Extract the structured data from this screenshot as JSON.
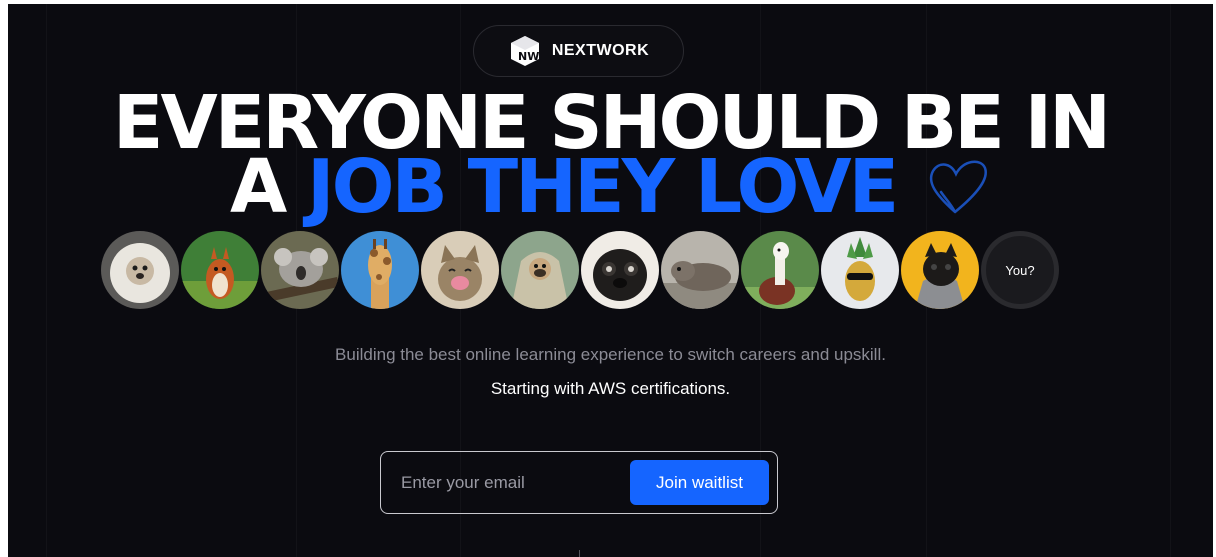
{
  "brand": {
    "logo_mark": "NW",
    "name": "NEXTWORK"
  },
  "hero": {
    "line1": "EVERYONE SHOULD BE IN",
    "line2_prefix": "A",
    "line2_highlight": "JOB THEY LOVE",
    "heart_icon": "heart-outline-icon"
  },
  "avatars": [
    {
      "name": "white-fluffy-dog"
    },
    {
      "name": "squirrel"
    },
    {
      "name": "koala"
    },
    {
      "name": "giraffe"
    },
    {
      "name": "laughing-cat"
    },
    {
      "name": "pug-in-blanket"
    },
    {
      "name": "pug-closeup"
    },
    {
      "name": "seal"
    },
    {
      "name": "alpaca"
    },
    {
      "name": "pineapple-with-sunglasses"
    },
    {
      "name": "pug-in-hoodie"
    }
  ],
  "you_label": "You?",
  "tagline": "Building the best online learning experience to switch careers and upskill.",
  "sub_tagline": "Starting with AWS certifications.",
  "form": {
    "email_placeholder": "Enter your email",
    "email_value": "",
    "button_label": "Join waitlist"
  },
  "colors": {
    "background": "#0b0b10",
    "accent": "#1565ff",
    "text": "#ffffff",
    "muted": "#8b8b95"
  }
}
